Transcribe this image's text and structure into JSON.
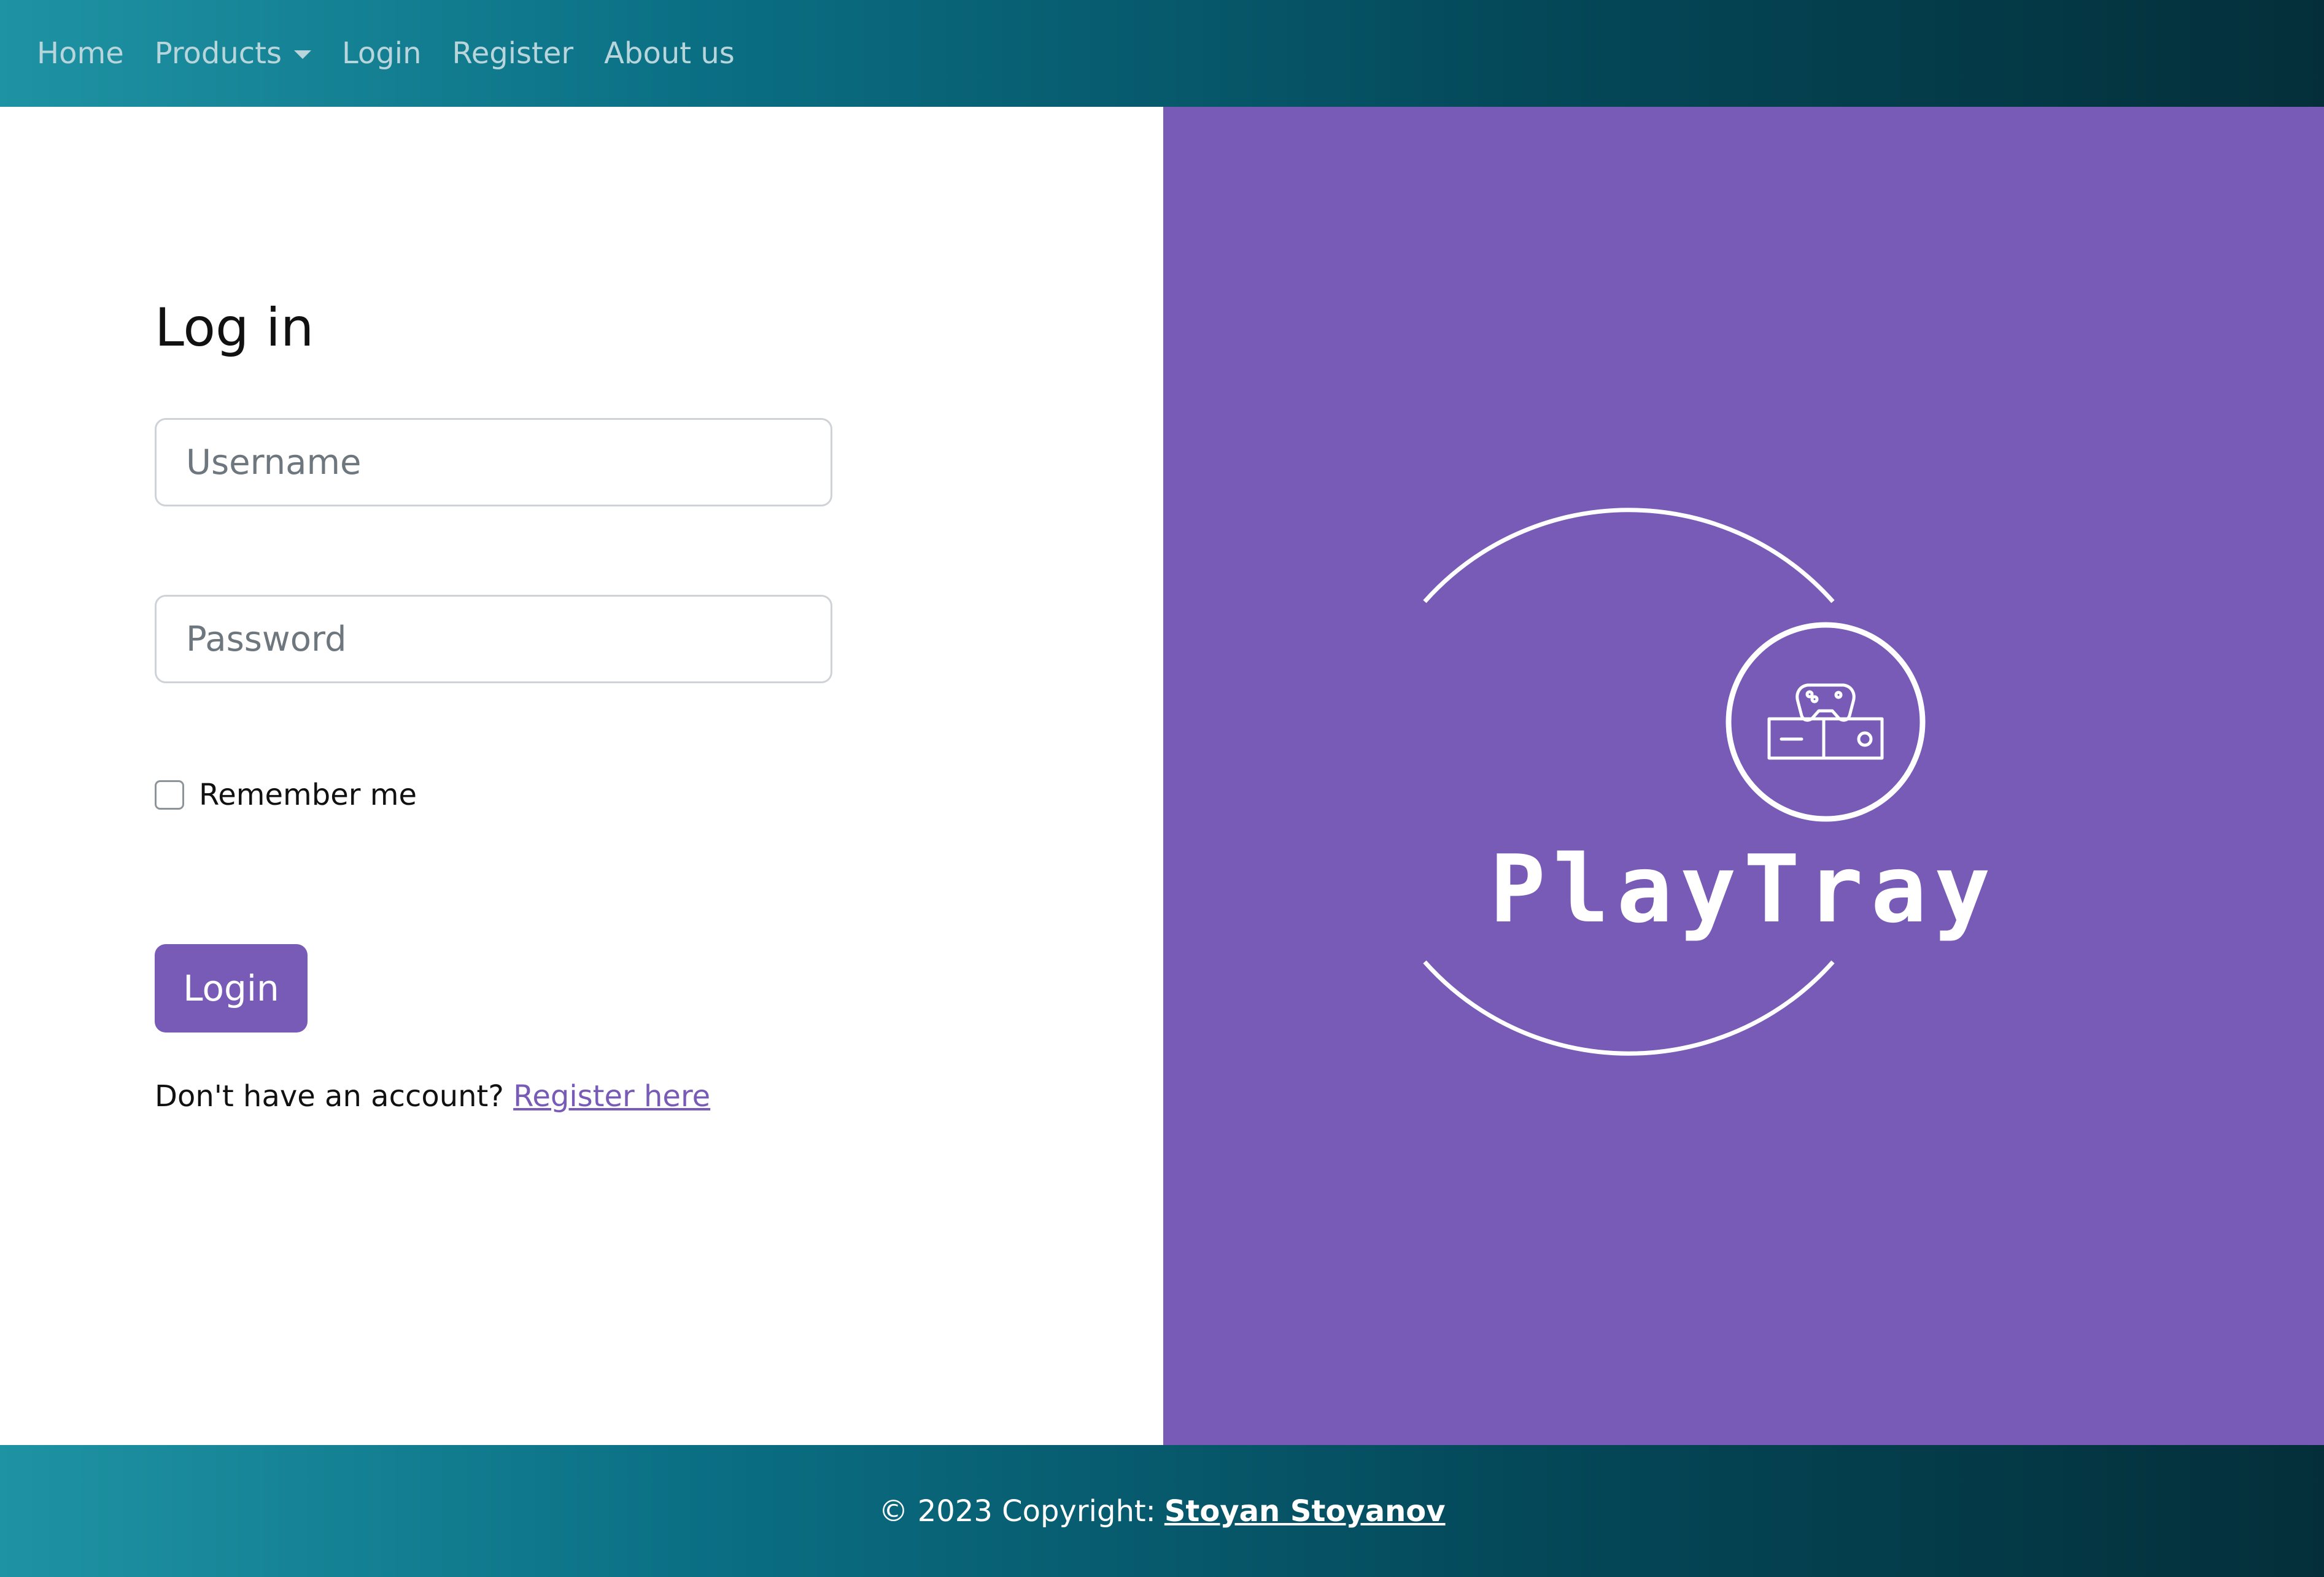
{
  "navbar": {
    "items": [
      {
        "label": "Home"
      },
      {
        "label": "Products",
        "has_dropdown": true
      },
      {
        "label": "Login"
      },
      {
        "label": "Register"
      },
      {
        "label": "About us"
      }
    ],
    "text_color": "#b9d5dc",
    "gradient": [
      "#1e93a3",
      "#042f3a"
    ]
  },
  "login_form": {
    "title": "Log in",
    "username_placeholder": "Username",
    "username_value": "",
    "password_placeholder": "Password",
    "password_value": "",
    "remember_label": "Remember me",
    "remember_checked": false,
    "submit_label": "Login",
    "no_account_text": "Don't have an account?",
    "register_link": "Register here"
  },
  "brand": {
    "name": "PlayTray",
    "icon": "game-console-icon",
    "panel_color": "#775bb6"
  },
  "footer": {
    "copyright": "© 2023 Copyright:",
    "author": "Stoyan Stoyanov"
  },
  "colors": {
    "accent": "#775bb6",
    "white": "#ffffff"
  }
}
